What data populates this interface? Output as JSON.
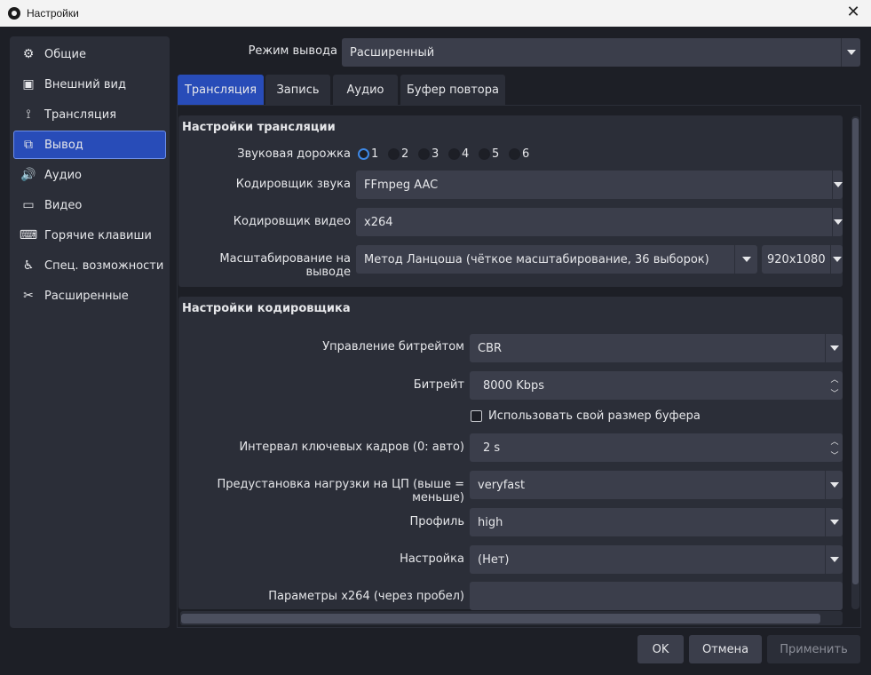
{
  "window": {
    "title": "Настройки",
    "close_glyph": "✕"
  },
  "sidebar": {
    "items": [
      {
        "label": "Общие",
        "icon": "gear-icon",
        "glyph": "⚙"
      },
      {
        "label": "Внешний вид",
        "icon": "appearance-icon",
        "glyph": "▣"
      },
      {
        "label": "Трансляция",
        "icon": "broadcast-icon",
        "glyph": "⟟"
      },
      {
        "label": "Вывод",
        "icon": "output-icon",
        "glyph": "⧉"
      },
      {
        "label": "Аудио",
        "icon": "speaker-icon",
        "glyph": "🔊"
      },
      {
        "label": "Видео",
        "icon": "monitor-icon",
        "glyph": "▭"
      },
      {
        "label": "Горячие клавиши",
        "icon": "keyboard-icon",
        "glyph": "⌨"
      },
      {
        "label": "Спец. возможности",
        "icon": "accessibility-icon",
        "glyph": "♿"
      },
      {
        "label": "Расширенные",
        "icon": "tools-icon",
        "glyph": "✂"
      }
    ],
    "active_index": 3
  },
  "output_mode": {
    "label": "Режим вывода",
    "value": "Расширенный"
  },
  "tabs": [
    {
      "label": "Трансляция",
      "active": true
    },
    {
      "label": "Запись",
      "active": false
    },
    {
      "label": "Аудио",
      "active": false
    },
    {
      "label": "Буфер повтора",
      "active": false
    }
  ],
  "stream_settings": {
    "title": "Настройки трансляции",
    "audio_track": {
      "label": "Звуковая дорожка",
      "options": [
        "1",
        "2",
        "3",
        "4",
        "5",
        "6"
      ],
      "selected": "1"
    },
    "audio_encoder": {
      "label": "Кодировщик звука",
      "value": "FFmpeg AAC"
    },
    "video_encoder": {
      "label": "Кодировщик видео",
      "value": "x264"
    },
    "rescale": {
      "label": "Масштабирование на выводе",
      "method": "Метод Ланцоша (чёткое масштабирование, 36 выборок)",
      "resolution": "920x1080"
    }
  },
  "encoder_settings": {
    "title": "Настройки кодировщика",
    "rate_control": {
      "label": "Управление битрейтом",
      "value": "CBR"
    },
    "bitrate": {
      "label": "Битрейт",
      "value": "8000 Kbps"
    },
    "custom_buffer": {
      "label": "Использовать свой размер буфера",
      "checked": false
    },
    "keyframe_interval": {
      "label": "Интервал ключевых кадров (0: авто)",
      "value": "2 s"
    },
    "cpu_preset": {
      "label": "Предустановка нагрузки на ЦП (выше = меньше)",
      "value": "veryfast"
    },
    "profile": {
      "label": "Профиль",
      "value": "high"
    },
    "tune": {
      "label": "Настройка",
      "value": "(Нет)"
    },
    "x264_options": {
      "label": "Параметры x264 (через пробел)",
      "value": ""
    }
  },
  "footer": {
    "ok": "OK",
    "cancel": "Отмена",
    "apply": "Применить"
  }
}
